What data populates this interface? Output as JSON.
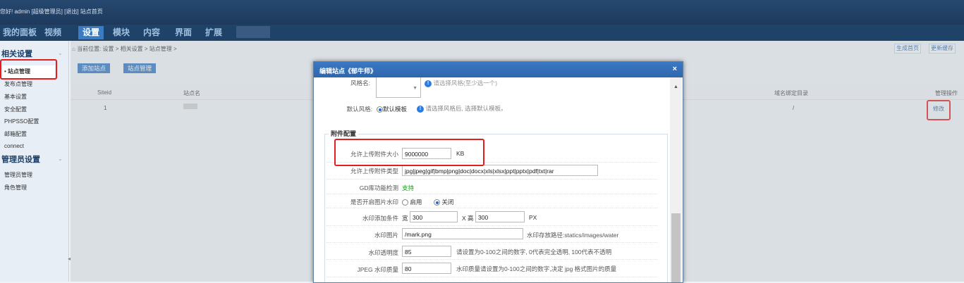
{
  "topbar": {
    "welcome": "您好! admin [超级管理员]  [退出]   站点首页"
  },
  "nav": {
    "tabs": [
      "我的面板",
      "视频",
      "设置",
      "模块",
      "内容",
      "界面",
      "扩展"
    ],
    "active": "设置"
  },
  "sidebar": {
    "section1": "相关设置",
    "active_item": "• 站点管理",
    "items1": [
      "发布点管理",
      "基本设置",
      "安全配置",
      "PHPSSO配置",
      "邮箱配置",
      "connect"
    ],
    "section2": "管理员设置",
    "items2": [
      "管理员管理",
      "角色管理"
    ]
  },
  "breadcrumb": {
    "home_icon": "home-icon",
    "text": "当前位置: 设置 > 相关设置 > 站点管理 >"
  },
  "toolbar": {
    "gen_home": "生成首页",
    "update_cache": "更新缓存"
  },
  "actions": {
    "add_site": "添加站点",
    "site_manage": "站点管理"
  },
  "table": {
    "headers": {
      "siteid": "Siteid",
      "name": "站点名",
      "dir": "域名绑定目录",
      "ops": "管理操作"
    },
    "row": {
      "siteid": "1",
      "dir": "/",
      "edit": "修改"
    }
  },
  "dialog": {
    "title": "编辑站点《郁牛师》",
    "close": "×",
    "skin_label": "风格名:",
    "skin_hint": "请选择风格(至少选一个)",
    "default_style_label": "默认风格:",
    "default_style_value": "默认模板",
    "default_style_hint": "请选择风格后, 选择默认模板。",
    "attach_legend": "附件配置",
    "fields": {
      "max_size_label": "允许上传附件大小",
      "max_size_value": "9000000",
      "max_size_unit": "KB",
      "types_label": "允许上传附件类型",
      "types_value": "jpg|jpeg|gif|bmp|png|doc|docx|xls|xlsx|ppt|pptx|pdf|txt|rar",
      "gd_label": "GD库功能检测",
      "gd_value": "支持",
      "watermark_label": "是否开启图片水印",
      "watermark_on": "启用",
      "watermark_off": "关闭",
      "cond_label": "水印添加条件",
      "cond_w_prefix": "宽",
      "cond_w": "300",
      "cond_h_prefix": "X 高",
      "cond_h": "300",
      "cond_unit": "PX",
      "img_label": "水印图片",
      "img_value": "/mark.png",
      "img_hint": "水印存放路径:statics/images/water",
      "alpha_label": "水印透明度",
      "alpha_value": "85",
      "alpha_hint": "请设置为0-100之间的数字, 0代表完全透明, 100代表不透明",
      "quality_label": "JPEG 水印质量",
      "quality_value": "80",
      "quality_hint": "水印质量请设置为0-100之间的数字,决定 jpg 格式图片的质量"
    }
  },
  "colors": {
    "accent": "#2e73c2",
    "highlight": "#e41e1e",
    "header": "#1f4268"
  }
}
